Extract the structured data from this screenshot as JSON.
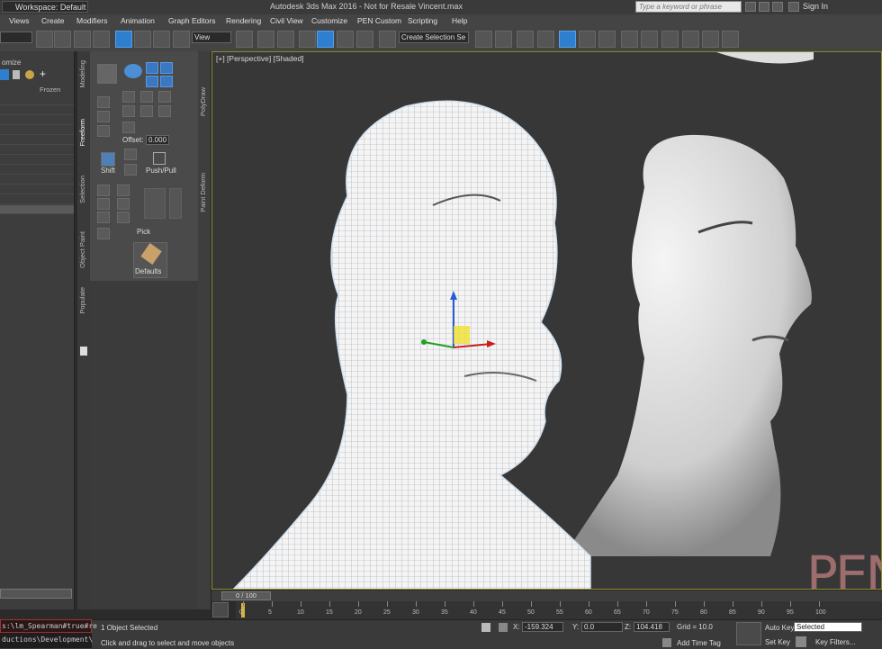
{
  "titlebar": {
    "workspace": "Workspace: Default",
    "title": "Autodesk 3ds Max 2016 - Not for Resale    Vincent.max",
    "search_placeholder": "Type a keyword or phrase",
    "sign_in": "Sign In"
  },
  "menu": [
    "Views",
    "Create",
    "Modifiers",
    "Animation",
    "Graph Editors",
    "Rendering",
    "Civil View",
    "Customize",
    "PEN Custom",
    "Scripting",
    "Help"
  ],
  "toolbar": {
    "view_dropdown": "View",
    "selection_set_dropdown": "Create Selection Se"
  },
  "explorer": {
    "header": "omize",
    "column": "Frozen"
  },
  "ribbon": {
    "tabs_left": [
      "Modeling",
      "Freeform",
      "Selection",
      "Object Paint",
      "Populate"
    ],
    "tabs_right": [
      "PolyDraw",
      "Paint Deform"
    ],
    "offset_label": "Offset:",
    "offset_value": "0.000",
    "shift": "Shift",
    "push_pull": "Push/Pull",
    "pick": "Pick",
    "defaults": "Defaults"
  },
  "viewport": {
    "label": "[+] [Perspective] [Shaded]"
  },
  "timeline": {
    "frame": "0 / 100",
    "ticks": [
      "0",
      "5",
      "10",
      "15",
      "20",
      "25",
      "30",
      "35",
      "40",
      "45",
      "50",
      "55",
      "60",
      "65",
      "70",
      "75",
      "80",
      "85",
      "90",
      "95",
      "100"
    ]
  },
  "maxscript": {
    "line1": "s:\\lm_Spearman#true#re",
    "line2": "ductions\\Development\\"
  },
  "status": {
    "selected": "1 Object Selected",
    "prompt": "Click and drag to select and move objects",
    "x_label": "X:",
    "x_value": "-159.324",
    "y_label": "Y:",
    "y_value": "0.0",
    "z_label": "Z:",
    "z_value": "104.418",
    "grid": "Grid = 10.0",
    "add_time_tag": "Add Time Tag",
    "auto_key": "Auto Key",
    "set_key": "Set Key",
    "selected_dropdown": "Selected",
    "key_filters": "Key Filters..."
  },
  "watermark": "PEN productions",
  "colors": {
    "viewport_bg": "#373737",
    "active_border": "#8d8c2b",
    "accent_blue": "#2f7fd1"
  }
}
